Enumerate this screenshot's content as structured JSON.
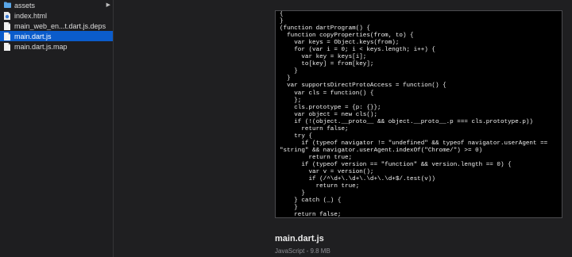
{
  "sidebar": {
    "items": [
      {
        "label": "assets",
        "kind": "folder",
        "has_children": true,
        "selected": false
      },
      {
        "label": "index.html",
        "kind": "html-file",
        "has_children": false,
        "selected": false
      },
      {
        "label": "main_web_en...t.dart.js.deps",
        "kind": "file",
        "has_children": false,
        "selected": false
      },
      {
        "label": "main.dart.js",
        "kind": "file",
        "has_children": false,
        "selected": true
      },
      {
        "label": "main.dart.js.map",
        "kind": "file",
        "has_children": false,
        "selected": false
      }
    ],
    "chevron": "▶"
  },
  "preview": {
    "code_lines": [
      "{",
      "}",
      "(function dartProgram() {",
      "  function copyProperties(from, to) {",
      "    var keys = Object.keys(from);",
      "    for (var i = 0; i < keys.length; i++) {",
      "      var key = keys[i];",
      "      to[key] = from[key];",
      "    }",
      "  }",
      "  var supportsDirectProtoAccess = function() {",
      "    var cls = function() {",
      "    };",
      "    cls.prototype = {p: {}};",
      "    var object = new cls();",
      "    if (!(object.__proto__ && object.__proto__.p === cls.prototype.p))",
      "      return false;",
      "    try {",
      "      if (typeof navigator != \"undefined\" && typeof navigator.userAgent ==",
      "\"string\" && navigator.userAgent.indexOf(\"Chrome/\") >= 0)",
      "        return true;",
      "      if (typeof version == \"function\" && version.length == 0) {",
      "        var v = version();",
      "        if (/^\\d+\\.\\d+\\.\\d+\\.\\d+$/.test(v))",
      "          return true;",
      "      }",
      "    } catch (_) {",
      "    }",
      "    return false;"
    ],
    "file_name": "main.dart.js",
    "file_info": "JavaScript - 9.8 MB"
  },
  "colors": {
    "selection": "#0b5ccb",
    "folder": "#5aa7e8",
    "background": "#1f1f21"
  }
}
